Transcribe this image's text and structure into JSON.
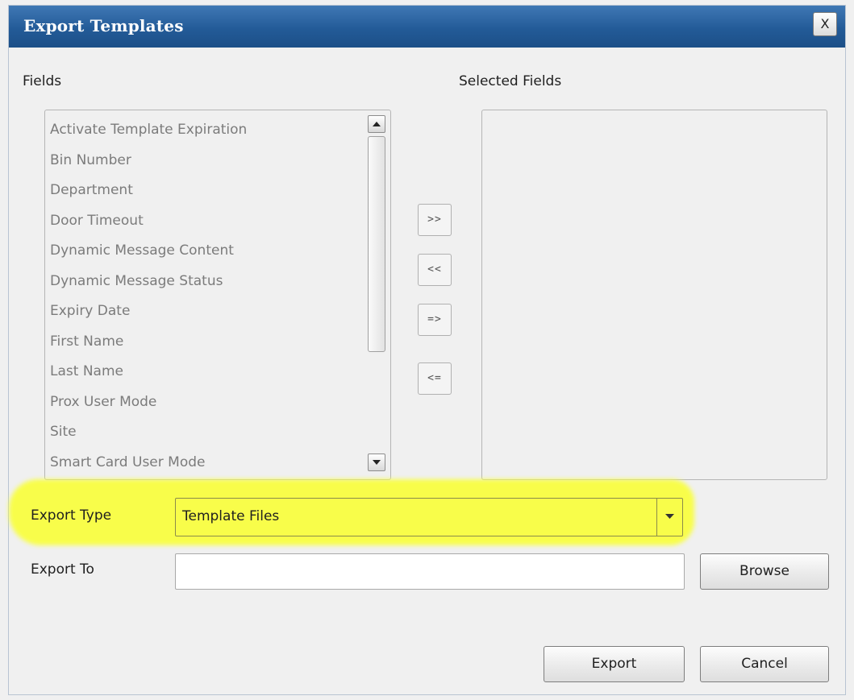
{
  "dialog": {
    "title": "Export Templates",
    "close_label": "X"
  },
  "fields": {
    "label": "Fields",
    "items": [
      "Activate Template Expiration",
      "Bin Number",
      "Department",
      "Door Timeout",
      "Dynamic Message Content",
      "Dynamic Message Status",
      "Expiry Date",
      "First Name",
      "Last Name",
      "Prox User Mode",
      "Site",
      "Smart Card User Mode"
    ]
  },
  "selected_fields": {
    "label": "Selected Fields"
  },
  "move_buttons": {
    "add": ">>",
    "remove": "<<",
    "add_all": "=>",
    "remove_all": "<="
  },
  "export_type": {
    "label": "Export Type",
    "value": "Template Files"
  },
  "export_to": {
    "label": "Export To",
    "value": "",
    "browse_label": "Browse"
  },
  "actions": {
    "export_label": "Export",
    "cancel_label": "Cancel"
  },
  "colors": {
    "titlebar": "#235b98",
    "highlight": "#f9ff3c"
  }
}
